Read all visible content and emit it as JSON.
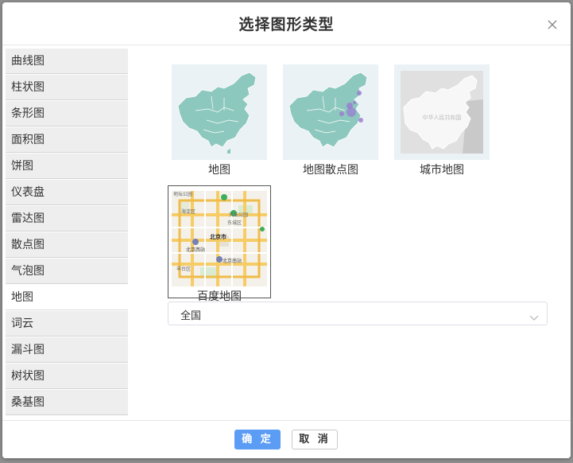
{
  "dialog": {
    "title": "选择图形类型",
    "close_icon": "close-icon"
  },
  "sidebar": {
    "items": [
      {
        "label": "曲线图"
      },
      {
        "label": "柱状图"
      },
      {
        "label": "条形图"
      },
      {
        "label": "面积图"
      },
      {
        "label": "饼图"
      },
      {
        "label": "仪表盘"
      },
      {
        "label": "雷达图"
      },
      {
        "label": "散点图"
      },
      {
        "label": "气泡图"
      },
      {
        "label": "地图",
        "active": true
      },
      {
        "label": "词云"
      },
      {
        "label": "漏斗图"
      },
      {
        "label": "树状图"
      },
      {
        "label": "桑基图"
      }
    ]
  },
  "map_types": [
    {
      "label": "地图",
      "thumb": "china-map-icon"
    },
    {
      "label": "地图散点图",
      "thumb": "china-scatter-map-icon"
    },
    {
      "label": "城市地图",
      "thumb": "city-map-icon",
      "watermark": "中华人民共和国"
    },
    {
      "label": "百度地图",
      "thumb": "baidu-map-icon",
      "selected": true,
      "map_labels": [
        "海淀区",
        "东城区",
        "北京市",
        "北京西站",
        "北京南站",
        "丰台区",
        "地坛公园",
        "天坛公园"
      ]
    }
  ],
  "region_select": {
    "value": "全国"
  },
  "footer": {
    "ok_label": "确 定",
    "cancel_label": "取 消"
  },
  "colors": {
    "accent": "#5b9cf4",
    "map_fill": "#8dc8be",
    "scatter_dot": "#9a7fd1"
  }
}
